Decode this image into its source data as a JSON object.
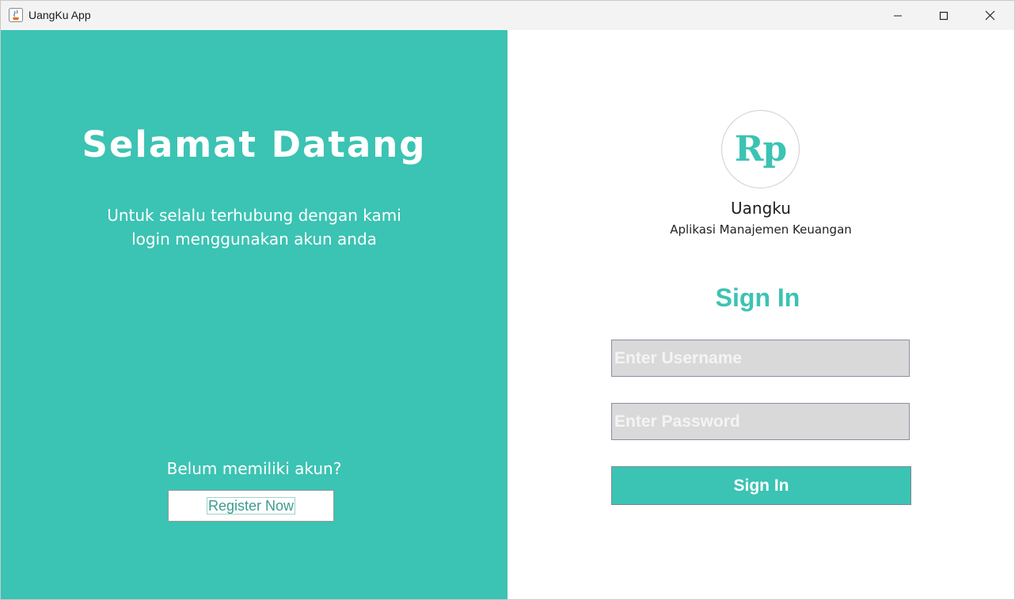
{
  "window": {
    "title": "UangKu App",
    "icons": {
      "app": "java-icon",
      "minimize": "minimize-icon",
      "maximize": "maximize-icon",
      "close": "close-icon"
    }
  },
  "left_panel": {
    "welcome": "Selamat Datang",
    "subtitle_line1": "Untuk selalu terhubung dengan kami",
    "subtitle_line2": "login menggunakan akun anda",
    "no_account_text": "Belum memiliki akun?",
    "register_label": "Register Now"
  },
  "right_panel": {
    "logo_text": "Rp",
    "app_name": "Uangku",
    "tagline": "Aplikasi Manajemen Keuangan",
    "signin_title": "Sign In",
    "username_placeholder": "Enter Username",
    "password_placeholder": "Enter Password",
    "signin_button": "Sign In"
  },
  "colors": {
    "accent": "#3bc3b3",
    "field_bg": "#d9d9d9",
    "titlebar": "#f3f3f3"
  }
}
